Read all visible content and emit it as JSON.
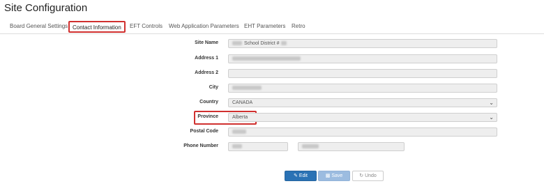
{
  "page_title": "Site Configuration",
  "tabs": [
    {
      "label": "Board General Settings"
    },
    {
      "label": "Contact Information",
      "active": true
    },
    {
      "label": "EFT Controls"
    },
    {
      "label": "Web Application Parameters"
    },
    {
      "label": "EHT Parameters"
    },
    {
      "label": "Retro"
    }
  ],
  "form": {
    "site_name": {
      "label": "Site Name",
      "value": "School District #"
    },
    "address1": {
      "label": "Address 1"
    },
    "address2": {
      "label": "Address 2"
    },
    "city": {
      "label": "City"
    },
    "country": {
      "label": "Country",
      "value": "CANADA"
    },
    "province": {
      "label": "Province",
      "value": "Alberta"
    },
    "postal_code": {
      "label": "Postal Code"
    },
    "phone_number": {
      "label": "Phone Number"
    }
  },
  "actions": {
    "edit": "Edit",
    "save": "Save",
    "undo": "Undo"
  },
  "icons": {
    "edit": "edit-icon",
    "save": "save-icon",
    "undo": "undo-icon",
    "dropdown": "chevron-down-icon"
  },
  "colors": {
    "highlight": "#d0302f",
    "primary": "#2a72b5",
    "disabled_primary": "#9cbce0"
  }
}
